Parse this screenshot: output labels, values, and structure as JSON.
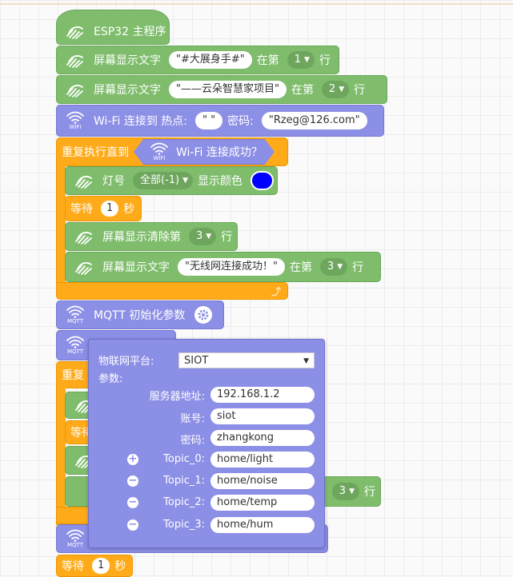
{
  "blocks": {
    "main_program": "ESP32 主程序",
    "screen_text_1": {
      "label": "屏幕显示文字",
      "text": "\"#大展身手#\"",
      "row_prefix": "在第",
      "row": "1",
      "row_suffix": "行"
    },
    "screen_text_2": {
      "label": "屏幕显示文字",
      "text": "\"——云朵智慧家项目\"",
      "row_prefix": "在第",
      "row": "2",
      "row_suffix": "行"
    },
    "wifi_connect": {
      "label": "Wi-Fi 连接到 热点:",
      "ssid": "\" \"",
      "password_label": "密码:",
      "password": "\"Rzeg@126.com\""
    },
    "repeat_until": {
      "label": "重复执行直到",
      "condition": "Wi-Fi 连接成功？"
    },
    "led": {
      "label": "灯号",
      "value": "全部(-1)",
      "color_label": "显示颜色",
      "color": "#0000ff"
    },
    "wait_1": {
      "label": "等待",
      "value": "1",
      "unit": "秒"
    },
    "screen_clear": {
      "label": "屏幕显示清除第",
      "row": "3",
      "row_suffix": "行"
    },
    "screen_text_3": {
      "label": "屏幕显示文字",
      "text": "\"无线网连接成功！\"",
      "row_prefix": "在第",
      "row": "3",
      "row_suffix": "行"
    },
    "mqtt_init": {
      "label": "MQTT 初始化参数"
    },
    "repeat_2_partial": "重复",
    "wait_2_partial": "等待",
    "row_3_right": {
      "row": "3",
      "row_suffix": "行"
    },
    "wait_bottom": {
      "label": "等待",
      "value": "1",
      "unit": "秒"
    }
  },
  "icon_labels": {
    "wifi": "WIFI",
    "mqtt": "MQTT"
  },
  "popup": {
    "platform_label": "物联网平台:",
    "platform_value": "SIOT",
    "params_label": "参数:",
    "fields": [
      {
        "label": "服务器地址:",
        "value": "192.168.1.2"
      },
      {
        "label": "账号:",
        "value": "siot"
      },
      {
        "label": "密码:",
        "value": "zhangkong"
      }
    ],
    "topics": [
      {
        "label": "Topic_0:",
        "value": "home/light",
        "action": "+"
      },
      {
        "label": "Topic_1:",
        "value": "home/noise",
        "action": "−"
      },
      {
        "label": "Topic_2:",
        "value": "home/temp",
        "action": "−"
      },
      {
        "label": "Topic_3:",
        "value": "home/hum",
        "action": "−"
      }
    ]
  },
  "colors": {
    "green": "#7fbd6c",
    "purple": "#8c8fe6",
    "orange": "#ffab19"
  }
}
